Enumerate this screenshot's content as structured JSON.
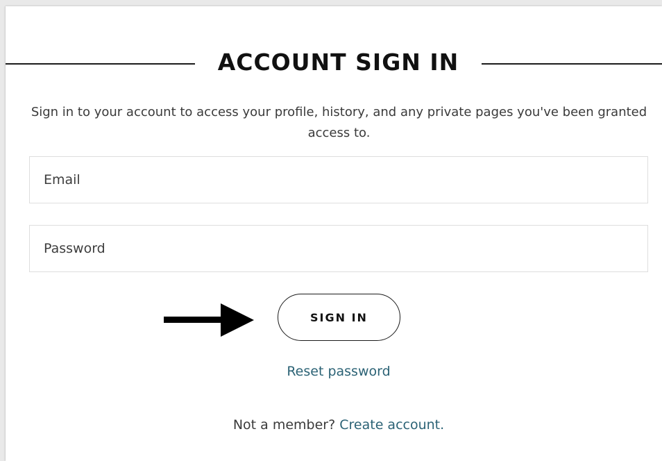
{
  "header": {
    "title": "ACCOUNT SIGN IN"
  },
  "intro": {
    "text": "Sign in to your account to access your profile, history, and any private pages you've been granted access to."
  },
  "form": {
    "email_placeholder": "Email",
    "email_value": "",
    "password_placeholder": "Password",
    "password_value": "",
    "signin_label": "SIGN IN"
  },
  "links": {
    "reset_password": "Reset password",
    "not_member_prefix": "Not a member?",
    "create_account": "Create account."
  },
  "icons": {
    "pointer_arrow": "arrow-right-icon"
  },
  "colors": {
    "text": "#111111",
    "link": "#2b6275",
    "border": "#dedede",
    "background": "#ffffff"
  }
}
